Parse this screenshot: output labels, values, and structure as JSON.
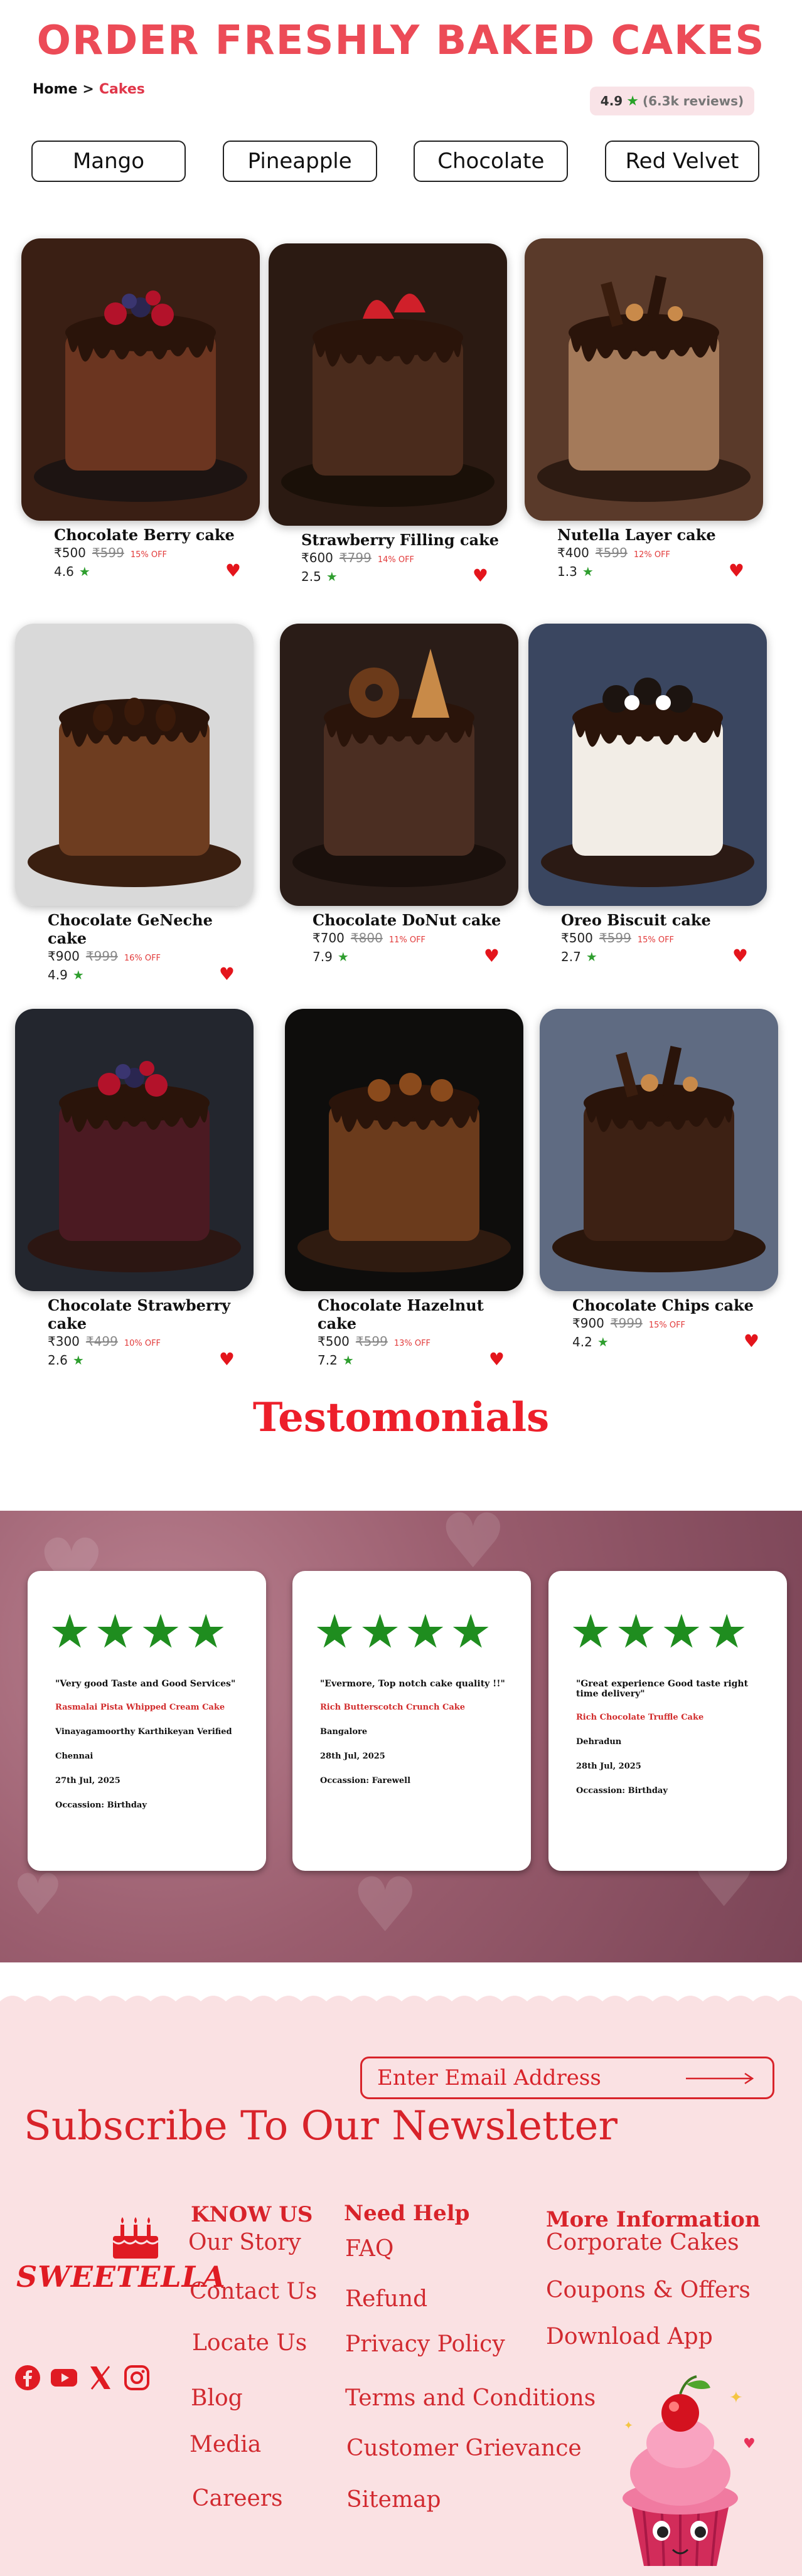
{
  "header": {
    "title": "ORDER FRESHLY BAKED CAKES",
    "breadcrumb_home": "Home",
    "breadcrumb_sep": ">",
    "breadcrumb_current": "Cakes",
    "rating_value": "4.9",
    "rating_reviews": "(6.3k reviews)"
  },
  "flavors": [
    "Mango",
    "Pineapple",
    "Chocolate",
    "Red Velvet"
  ],
  "products": [
    {
      "name": "Chocolate Berry cake",
      "price": "₹500",
      "mrp": "₹599",
      "off": "15% OFF",
      "rating": "4.6"
    },
    {
      "name": "Strawberry Filling cake",
      "price": "₹600",
      "mrp": "₹799",
      "off": "14% OFF",
      "rating": "2.5"
    },
    {
      "name": "Nutella Layer cake",
      "price": "₹400",
      "mrp": "₹599",
      "off": "12% OFF",
      "rating": "1.3"
    },
    {
      "name": "Chocolate GeNeche cake",
      "price": "₹900",
      "mrp": "₹999",
      "off": "16% OFF",
      "rating": "4.9"
    },
    {
      "name": "Chocolate DoNut cake",
      "price": "₹700",
      "mrp": "₹800",
      "off": "11% OFF",
      "rating": "7.9"
    },
    {
      "name": "Oreo Biscuit cake",
      "price": "₹500",
      "mrp": "₹599",
      "off": "15% OFF",
      "rating": "2.7"
    },
    {
      "name": "Chocolate Strawberry cake",
      "price": "₹300",
      "mrp": "₹499",
      "off": "10% OFF",
      "rating": "2.6"
    },
    {
      "name": "Chocolate Hazelnut cake",
      "price": "₹500",
      "mrp": "₹599",
      "off": "13% OFF",
      "rating": "7.2"
    },
    {
      "name": "Chocolate Chips cake",
      "price": "₹900",
      "mrp": "₹999",
      "off": "15% OFF",
      "rating": "4.2"
    }
  ],
  "testimonials_title": "Testomonials",
  "testimonials": [
    {
      "quote": "\"Very good Taste and Good Services\"",
      "cake": "Rasmalai Pista Whipped Cream Cake",
      "name": "Vinayagamoorthy Karthikeyan Verified",
      "city": "Chennai",
      "date": "27th Jul, 2025",
      "occasion": "Occassion: Birthday"
    },
    {
      "quote": "\"Evermore, Top notch cake quality !!\"",
      "cake": "Rich Butterscotch Crunch Cake",
      "name": "",
      "city": "Bangalore",
      "date": "28th Jul, 2025",
      "occasion": "Occassion: Farewell"
    },
    {
      "quote": "\"Great experience Good taste right time delivery\"",
      "cake": "Rich Chocolate Truffle Cake",
      "name": "",
      "city": "Dehradun",
      "date": "28th Jul, 2025",
      "occasion": "Occassion: Birthday"
    }
  ],
  "newsletter": {
    "email_placeholder": "Enter Email Address",
    "title": "Subscribe To Our Newsletter"
  },
  "brand": {
    "name": "SWEETELLA"
  },
  "footer": {
    "know_us": {
      "head": "KNOW US",
      "links": [
        "Our Story",
        "Contact Us",
        "Locate Us",
        "Blog",
        "Media",
        "Careers"
      ]
    },
    "need_help": {
      "head": "Need Help",
      "links": [
        "FAQ",
        "Refund",
        "Privacy Policy",
        "Terms and Conditions",
        "Customer Grievance",
        "Sitemap"
      ]
    },
    "more_info": {
      "head": "More Information",
      "links": [
        "Corporate Cakes",
        "Coupons  & Offers",
        "Download App"
      ]
    }
  },
  "colors": {
    "accent": "#ec4b57",
    "brand_red": "#d8232a",
    "star_green": "#27a227",
    "footer_bg": "#fae1e3"
  },
  "icons": [
    "star-icon",
    "heart-icon",
    "facebook-icon",
    "youtube-icon",
    "x-icon",
    "instagram-icon",
    "arrow-right-icon",
    "cake-icon"
  ]
}
